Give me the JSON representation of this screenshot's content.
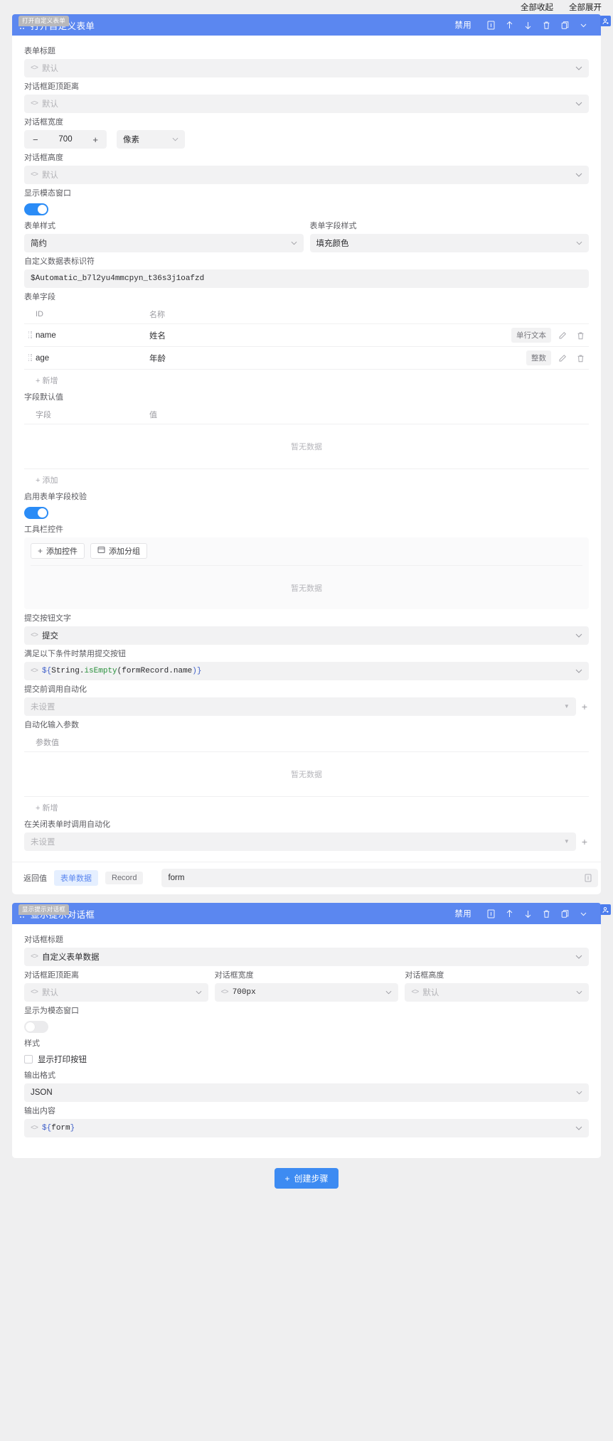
{
  "topbar": {
    "collapse_all": "全部收起",
    "expand_all": "全部展开"
  },
  "step1": {
    "tag": "打开自定义表单",
    "title": "打开自定义表单",
    "header": {
      "disable_label": "禁用",
      "icons": [
        "note-icon",
        "arrow-up-icon",
        "arrow-down-icon",
        "trash-icon",
        "copy-icon",
        "chevron-down-icon"
      ],
      "badge_icon": "user-badge-icon"
    },
    "form_title": {
      "label": "表单标题",
      "value": "默认"
    },
    "dialog_top": {
      "label": "对话框距顶距离",
      "value": "默认"
    },
    "dialog_width": {
      "label": "对话框宽度",
      "value": "700",
      "minus": "−",
      "plus": "+",
      "unit": "像素"
    },
    "dialog_height": {
      "label": "对话框高度",
      "value": "默认"
    },
    "show_modal": {
      "label": "显示模态窗口",
      "state": "on"
    },
    "form_style": {
      "label": "表单样式",
      "value": "简约"
    },
    "field_style": {
      "label": "表单字段样式",
      "value": "填充颜色"
    },
    "table_id": {
      "label": "自定义数据表标识符",
      "value": "$Automatic_b7l2yu4mmcpyn_t36s3j1oafzd"
    },
    "form_fields": {
      "label": "表单字段",
      "columns": [
        "ID",
        "名称"
      ],
      "rows": [
        {
          "id": "name",
          "name": "姓名",
          "type": "单行文本"
        },
        {
          "id": "age",
          "name": "年龄",
          "type": "整数"
        }
      ],
      "add_label": "+ 新增"
    },
    "field_defaults": {
      "label": "字段默认值",
      "columns": [
        "字段",
        "值"
      ],
      "empty": "暂无数据",
      "add_label": "+ 添加"
    },
    "enable_validation": {
      "label": "启用表单字段校验",
      "state": "on"
    },
    "toolbar_controls": {
      "label": "工具栏控件",
      "add_control": "添加控件",
      "add_group": "添加分组",
      "empty": "暂无数据"
    },
    "submit_text": {
      "label": "提交按钮文字",
      "value": "提交"
    },
    "disable_condition": {
      "label": "满足以下条件时禁用提交按钮",
      "value": "${String.isEmpty(formRecord.name)}",
      "tokens": [
        {
          "t": "${",
          "c": "b"
        },
        {
          "t": "String.",
          "c": "d"
        },
        {
          "t": "isEmpty",
          "c": "g"
        },
        {
          "t": "(formRecord.name",
          "c": "d"
        },
        {
          "t": ")}",
          "c": "b"
        }
      ]
    },
    "pre_submit_automation": {
      "label": "提交前调用自动化",
      "value": "未设置"
    },
    "automation_inputs": {
      "label": "自动化输入参数",
      "columns": [
        "参数值"
      ],
      "empty": "暂无数据",
      "add_label": "+ 新增"
    },
    "on_close_automation": {
      "label": "在关闭表单时调用自动化",
      "value": "未设置"
    },
    "returns": {
      "label": "返回值",
      "tabs": [
        {
          "label": "表单数据",
          "active": true
        },
        {
          "label": "Record",
          "active": false
        }
      ],
      "value": "form"
    }
  },
  "step2": {
    "tag": "显示提示对话框",
    "title": "显示提示对话框",
    "header": {
      "disable_label": "禁用",
      "icons": [
        "note-icon",
        "arrow-up-icon",
        "arrow-down-icon",
        "trash-icon",
        "copy-icon",
        "chevron-down-icon"
      ],
      "badge_icon": "user-badge-icon"
    },
    "dialog_title": {
      "label": "对话框标题",
      "value": "自定义表单数据"
    },
    "dialog_top": {
      "label": "对话框距顶距离",
      "value": "默认"
    },
    "dialog_width": {
      "label": "对话框宽度",
      "value": "700px"
    },
    "dialog_height": {
      "label": "对话框高度",
      "value": "默认"
    },
    "show_modal": {
      "label": "显示为模态窗口",
      "state": "off"
    },
    "style": {
      "label": "样式",
      "print_label": "显示打印按钮",
      "checked": false
    },
    "output_format": {
      "label": "输出格式",
      "value": "JSON"
    },
    "output_content": {
      "label": "输出内容",
      "value": "${form}",
      "tokens": [
        {
          "t": "${",
          "c": "b"
        },
        {
          "t": "form",
          "c": "d"
        },
        {
          "t": "}",
          "c": "b"
        }
      ]
    }
  },
  "footer": {
    "create_step": "创建步骤",
    "plus": "+"
  },
  "colors": {
    "accent": "#5b87f0",
    "toggle_on": "#2b8cf6",
    "button": "#3d8bf2"
  }
}
